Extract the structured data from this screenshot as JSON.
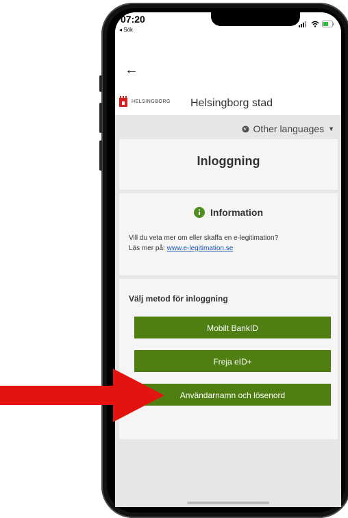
{
  "status_bar": {
    "time": "07:20",
    "back_app": "◂ Sök"
  },
  "header": {
    "back_icon": "arrow-left-icon",
    "logo_text": "HELSINGBORG",
    "site_name": "Helsingborg stad"
  },
  "language": {
    "label": "Other languages",
    "icon": "globe-icon"
  },
  "login_card": {
    "title": "Inloggning"
  },
  "info_card": {
    "title": "Information",
    "line1": "Vill du veta mer om eller skaffa en e-legitimation?",
    "line2_prefix": "Läs mer på: ",
    "link": "www.e-legitimation.se"
  },
  "method_card": {
    "title": "Välj metod för inloggning",
    "buttons": [
      "Mobilt BankID",
      "Freja eID+",
      "Användarnamn och lösenord"
    ]
  },
  "colors": {
    "button_green": "#4f7f12",
    "info_green": "#4f8f1f",
    "annotation_red": "#e3140f"
  }
}
